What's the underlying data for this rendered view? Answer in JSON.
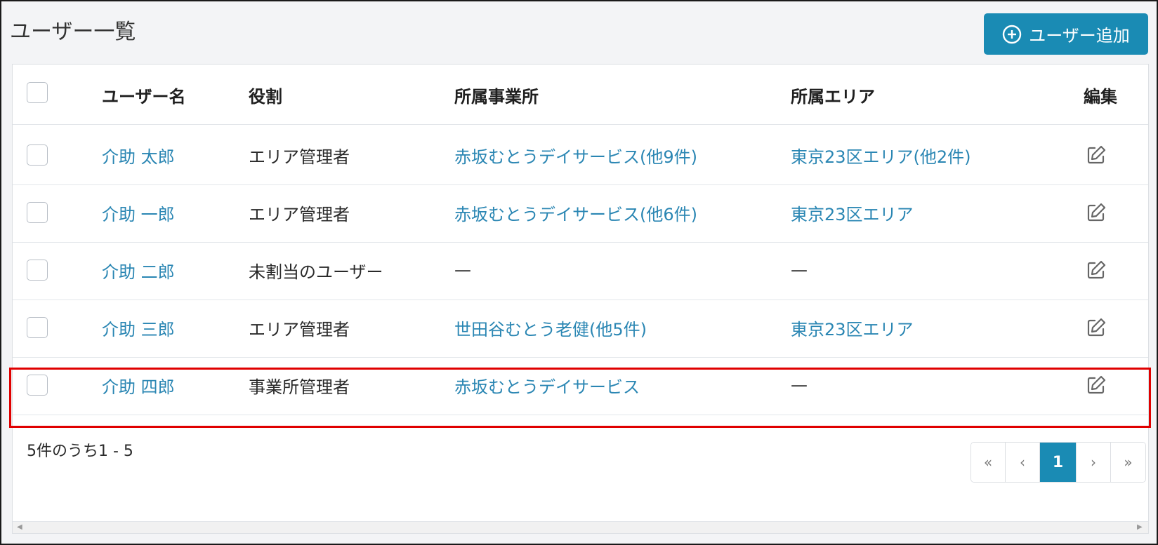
{
  "page": {
    "title": "ユーザー一覧"
  },
  "toolbar": {
    "add_user_label": "ユーザー追加"
  },
  "table": {
    "headers": {
      "name": "ユーザー名",
      "role": "役割",
      "office": "所属事業所",
      "area": "所属エリア",
      "edit": "編集"
    },
    "rows": [
      {
        "name": "介助 太郎",
        "role": "エリア管理者",
        "office": "赤坂むとうデイサービス(他9件)",
        "area": "東京23区エリア(他2件)"
      },
      {
        "name": "介助 一郎",
        "role": "エリア管理者",
        "office": "赤坂むとうデイサービス(他6件)",
        "area": "東京23区エリア"
      },
      {
        "name": "介助 二郎",
        "role": "未割当のユーザー",
        "office": "—",
        "area": "—"
      },
      {
        "name": "介助 三郎",
        "role": "エリア管理者",
        "office": "世田谷むとう老健(他5件)",
        "area": "東京23区エリア"
      },
      {
        "name": "介助 四郎",
        "role": "事業所管理者",
        "office": "赤坂むとうデイサービス",
        "area": "—"
      }
    ]
  },
  "footer": {
    "count_text": "5件のうち1 - 5",
    "pagination": {
      "first": "«",
      "prev": "‹",
      "current": "1",
      "next": "›",
      "last": "»"
    }
  },
  "colors": {
    "accent": "#1a8bb4",
    "link": "#2a86b3",
    "highlight": "#e00000"
  }
}
